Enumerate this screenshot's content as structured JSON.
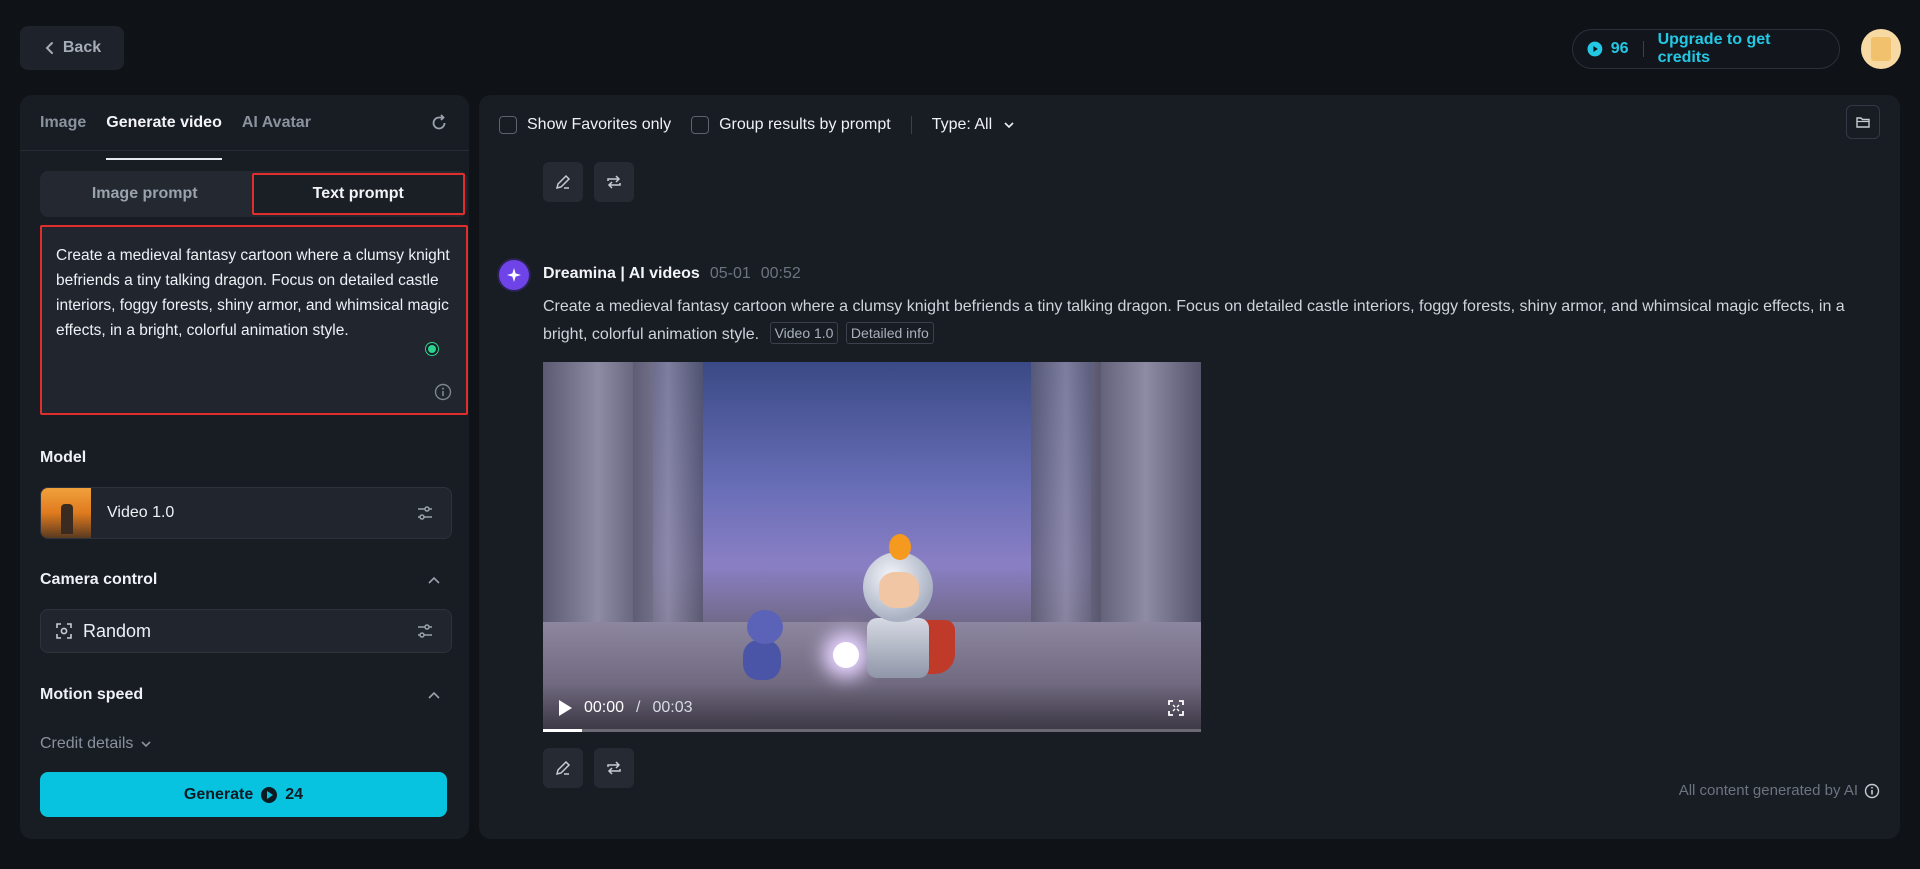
{
  "topbar": {
    "back_label": "Back",
    "credits_count": "96",
    "upgrade_label": "Upgrade to get credits"
  },
  "left": {
    "tabs": [
      {
        "label": "Image"
      },
      {
        "label": "Generate video"
      },
      {
        "label": "AI Avatar"
      }
    ],
    "prompt_toggle": {
      "image_label": "Image prompt",
      "text_label": "Text prompt"
    },
    "prompt_text": "Create a medieval fantasy cartoon where a clumsy knight befriends a tiny talking dragon. Focus on detailed castle interiors, foggy forests, shiny armor, and whimsical magic effects, in a bright, colorful animation style.",
    "model_title": "Model",
    "model_name": "Video 1.0",
    "camera_title": "Camera control",
    "camera_value": "Random",
    "motion_title": "Motion speed",
    "credit_details_label": "Credit details",
    "generate_label": "Generate",
    "generate_cost": "24"
  },
  "main": {
    "filters": {
      "favorites_label": "Show Favorites only",
      "group_label": "Group results by prompt",
      "type_label": "Type: All"
    },
    "post": {
      "author": "Dreamina | AI videos",
      "date": "05-01",
      "time": "00:52",
      "text": "Create a medieval fantasy cartoon where a clumsy knight befriends a tiny talking dragon. Focus on detailed castle interiors, foggy forests, shiny armor, and whimsical magic effects, in a bright, colorful animation style.",
      "tag_model": "Video 1.0",
      "tag_info": "Detailed info"
    },
    "video": {
      "current_time": "00:00",
      "separator": "/",
      "total_time": "00:03",
      "progress": 0.06
    },
    "ai_note": "All content generated by AI"
  },
  "colors": {
    "accent": "#07c3e0",
    "highlight_border": "#e02e2e",
    "panel_bg": "#181c23",
    "page_bg": "#0f1318"
  },
  "icons": [
    "chevron-left-icon",
    "credit-icon",
    "refresh-icon",
    "info-icon",
    "slider-icon",
    "chevron-up-icon",
    "camera-focus-icon",
    "chevron-down-icon",
    "folder-icon",
    "edit-icon",
    "repeat-icon",
    "play-icon",
    "fullscreen-icon",
    "dreamina-logo-icon"
  ]
}
